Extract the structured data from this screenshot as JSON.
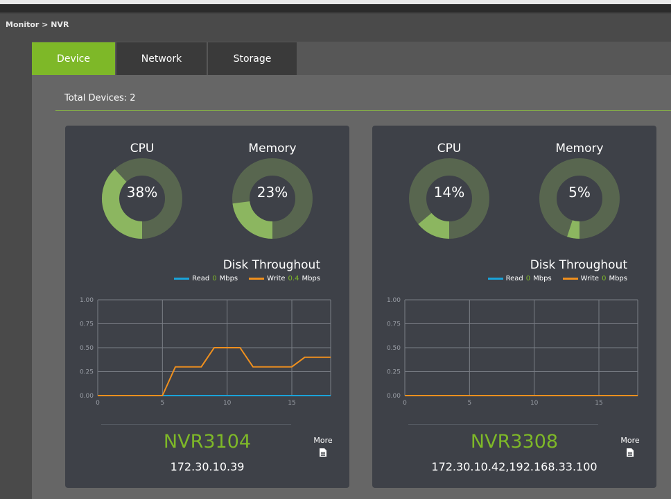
{
  "breadcrumb": "Monitor > NVR",
  "tabs": [
    {
      "label": "Device",
      "active": true
    },
    {
      "label": "Network",
      "active": false
    },
    {
      "label": "Storage",
      "active": false
    }
  ],
  "total_devices_label": "Total Devices: 2",
  "colors": {
    "accent": "#7eb828",
    "gauge_fill": "#8cb660",
    "gauge_track": "#58664f",
    "card_bg": "#3e4148",
    "read_line": "#1aa3d9",
    "write_line": "#f0901e"
  },
  "devices": [
    {
      "name": "NVR3104",
      "ip": "172.30.10.39",
      "cpu_title": "CPU",
      "cpu_percent": 38,
      "cpu_label": "38%",
      "memory_title": "Memory",
      "memory_percent": 23,
      "memory_label": "23%",
      "disk_title": "Disk Throughout",
      "read_label": "Read",
      "read_value": "0",
      "write_label": "Write",
      "write_value": "0.4",
      "unit": "Mbps",
      "more_label": "More",
      "more_icon": "document-icon"
    },
    {
      "name": "NVR3308",
      "ip": "172.30.10.42,192.168.33.100",
      "cpu_title": "CPU",
      "cpu_percent": 14,
      "cpu_label": "14%",
      "memory_title": "Memory",
      "memory_percent": 5,
      "memory_label": "5%",
      "disk_title": "Disk Throughout",
      "read_label": "Read",
      "read_value": "0",
      "write_label": "Write",
      "write_value": "0",
      "unit": "Mbps",
      "more_label": "More",
      "more_icon": "document-icon"
    }
  ],
  "chart_data": [
    {
      "type": "line",
      "x": [
        0,
        1,
        2,
        3,
        4,
        5,
        6,
        7,
        8,
        9,
        10,
        11,
        12,
        13,
        14,
        15,
        16,
        17,
        18
      ],
      "xticks": [
        0,
        5,
        10,
        15
      ],
      "xlim": [
        0,
        18
      ],
      "ylim": [
        0,
        1
      ],
      "yticks": [
        "0.00",
        "0.25",
        "0.50",
        "0.75",
        "1.00"
      ],
      "series": [
        {
          "name": "Read",
          "values": [
            0,
            0,
            0,
            0,
            0,
            0,
            0,
            0,
            0,
            0,
            0,
            0,
            0,
            0,
            0,
            0,
            0,
            0,
            0
          ]
        },
        {
          "name": "Write",
          "values": [
            0,
            0,
            0,
            0,
            0,
            0,
            0.3,
            0.3,
            0.3,
            0.5,
            0.5,
            0.5,
            0.3,
            0.3,
            0.3,
            0.3,
            0.4,
            0.4,
            0.4
          ]
        }
      ]
    },
    {
      "type": "line",
      "x": [
        0,
        1,
        2,
        3,
        4,
        5,
        6,
        7,
        8,
        9,
        10,
        11,
        12,
        13,
        14,
        15,
        16,
        17,
        18
      ],
      "xticks": [
        0,
        5,
        10,
        15
      ],
      "xlim": [
        0,
        18
      ],
      "ylim": [
        0,
        1
      ],
      "yticks": [
        "0.00",
        "0.25",
        "0.50",
        "0.75",
        "1.00"
      ],
      "series": [
        {
          "name": "Read",
          "values": [
            0,
            0,
            0,
            0,
            0,
            0,
            0,
            0,
            0,
            0,
            0,
            0,
            0,
            0,
            0,
            0,
            0,
            0,
            0
          ]
        },
        {
          "name": "Write",
          "values": [
            0,
            0,
            0,
            0,
            0,
            0,
            0,
            0,
            0,
            0,
            0,
            0,
            0,
            0,
            0,
            0,
            0,
            0,
            0
          ]
        }
      ]
    }
  ]
}
